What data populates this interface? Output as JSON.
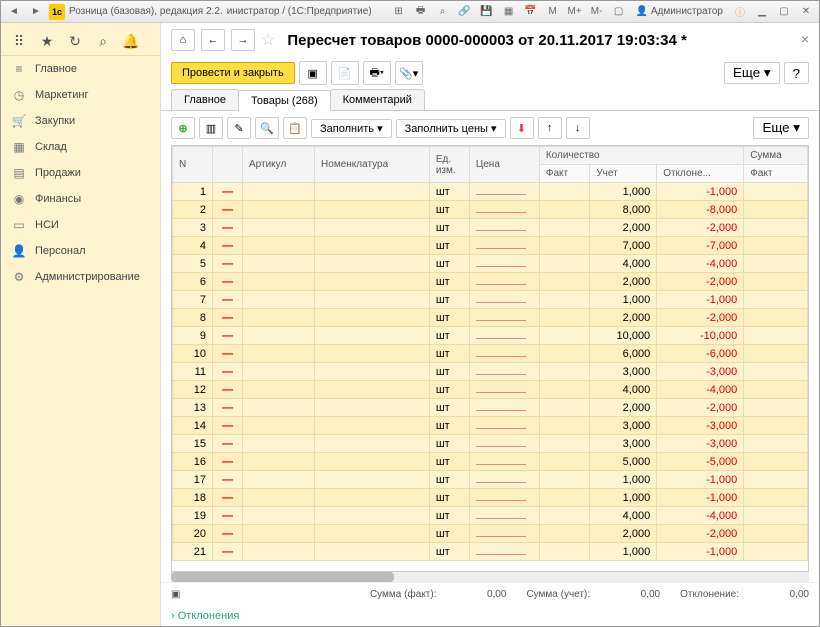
{
  "titlebar": {
    "app_icon": "1с",
    "title1": "Розница (базовая), редакция 2.2.",
    "title2": "инистратор /  (1С:Предприятие)",
    "user": "Администратор",
    "m": "М",
    "mplus": "М+",
    "mminus": "М-"
  },
  "sidebar": {
    "items": [
      {
        "icon": "≡",
        "label": "Главное"
      },
      {
        "icon": "◷",
        "label": "Маркетинг"
      },
      {
        "icon": "🛒",
        "label": "Закупки"
      },
      {
        "icon": "▦",
        "label": "Склад"
      },
      {
        "icon": "▤",
        "label": "Продажи"
      },
      {
        "icon": "◉",
        "label": "Финансы"
      },
      {
        "icon": "▭",
        "label": "НСИ"
      },
      {
        "icon": "👤",
        "label": "Персонал"
      },
      {
        "icon": "⚙",
        "label": "Администрирование"
      }
    ]
  },
  "doc": {
    "title": "Пересчет товаров 0000-000003 от 20.11.2017 19:03:34 *",
    "save_close": "Провести и закрыть",
    "more": "Еще",
    "help": "?"
  },
  "tabs": [
    {
      "label": "Главное"
    },
    {
      "label": "Товары (268)"
    },
    {
      "label": "Комментарий"
    }
  ],
  "table_toolbar": {
    "fill": "Заполнить",
    "fill_prices": "Заполнить цены",
    "more": "Еще"
  },
  "columns": {
    "n": "N",
    "art": "Артикул",
    "nom": "Номенклатура",
    "unit": "Ед. изм.",
    "price": "Цена",
    "qty": "Количество",
    "sum": "Сумма",
    "fact": "Факт",
    "uchet": "Учет",
    "otk": "Отклоне...",
    "sumfact": "Факт"
  },
  "rows": [
    {
      "n": 1,
      "unit": "шт",
      "uchet": "1,000",
      "otk": "-1,000"
    },
    {
      "n": 2,
      "unit": "шт",
      "uchet": "8,000",
      "otk": "-8,000"
    },
    {
      "n": 3,
      "unit": "шт",
      "uchet": "2,000",
      "otk": "-2,000"
    },
    {
      "n": 4,
      "unit": "шт",
      "uchet": "7,000",
      "otk": "-7,000"
    },
    {
      "n": 5,
      "unit": "шт",
      "uchet": "4,000",
      "otk": "-4,000"
    },
    {
      "n": 6,
      "unit": "шт",
      "uchet": "2,000",
      "otk": "-2,000"
    },
    {
      "n": 7,
      "unit": "шт",
      "uchet": "1,000",
      "otk": "-1,000"
    },
    {
      "n": 8,
      "unit": "шт",
      "uchet": "2,000",
      "otk": "-2,000"
    },
    {
      "n": 9,
      "unit": "шт",
      "uchet": "10,000",
      "otk": "-10,000"
    },
    {
      "n": 10,
      "unit": "шт",
      "uchet": "6,000",
      "otk": "-6,000"
    },
    {
      "n": 11,
      "unit": "шт",
      "uchet": "3,000",
      "otk": "-3,000"
    },
    {
      "n": 12,
      "unit": "шт",
      "uchet": "4,000",
      "otk": "-4,000"
    },
    {
      "n": 13,
      "unit": "шт",
      "uchet": "2,000",
      "otk": "-2,000"
    },
    {
      "n": 14,
      "unit": "шт",
      "uchet": "3,000",
      "otk": "-3,000"
    },
    {
      "n": 15,
      "unit": "шт",
      "uchet": "3,000",
      "otk": "-3,000"
    },
    {
      "n": 16,
      "unit": "шт",
      "uchet": "5,000",
      "otk": "-5,000"
    },
    {
      "n": 17,
      "unit": "шт",
      "uchet": "1,000",
      "otk": "-1,000"
    },
    {
      "n": 18,
      "unit": "шт",
      "uchet": "1,000",
      "otk": "-1,000"
    },
    {
      "n": 19,
      "unit": "шт",
      "uchet": "4,000",
      "otk": "-4,000"
    },
    {
      "n": 20,
      "unit": "шт",
      "uchet": "2,000",
      "otk": "-2,000"
    },
    {
      "n": 21,
      "unit": "шт",
      "uchet": "1,000",
      "otk": "-1,000"
    }
  ],
  "footer": {
    "sum_fact_lbl": "Сумма (факт):",
    "sum_fact": "0,00",
    "sum_uchet_lbl": "Сумма (учет):",
    "sum_uchet": "0,00",
    "otk_lbl": "Отклонение:",
    "otk": "0,00"
  },
  "deviations": "Отклонения"
}
